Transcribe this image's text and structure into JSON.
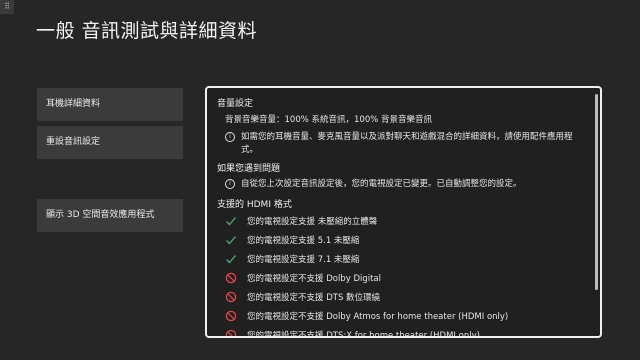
{
  "corner_glyph": "⠿",
  "title": "一般  音訊測試與詳細資料",
  "sidebar": [
    {
      "label": "耳機詳細資料"
    },
    {
      "label": "重設音訊設定"
    },
    {
      "label": "顯示 3D 空間音效應用程式"
    }
  ],
  "panel": {
    "volume_heading": "音量設定",
    "volume_line": "背景音樂音量：100% 系統音訊，100% 背景音樂音訊",
    "volume_info": "如需您的耳機音量、麥克風音量以及派對聊天和遊戲混合的詳細資料，請使用配件應用程式。",
    "problem_heading": "如果您遇到問題",
    "problem_info": "自從您上次設定音訊設定後，您的電視設定已變更。已自動調整您的設定。",
    "hdmi_heading": "支援的 HDMI 格式",
    "formats": [
      {
        "status": "supported",
        "icon": "check-icon",
        "text": "您的電視設定支援 未壓縮的立體聲"
      },
      {
        "status": "supported",
        "icon": "check-icon",
        "text": "您的電視設定支援 5.1 未壓縮"
      },
      {
        "status": "supported",
        "icon": "check-icon",
        "text": "您的電視設定支援 7.1 未壓縮"
      },
      {
        "status": "unsupported",
        "icon": "prohibited-icon",
        "text": "您的電視設定不支援 Dolby Digital"
      },
      {
        "status": "unsupported",
        "icon": "prohibited-icon",
        "text": "您的電視設定不支援 DTS 數位環繞"
      },
      {
        "status": "unsupported",
        "icon": "prohibited-icon",
        "text": "您的電視設定不支援 Dolby Atmos for home theater (HDMI only)"
      },
      {
        "status": "unsupported",
        "icon": "prohibited-icon",
        "text": "您的電視設定不支援 DTS:X for home theater (HDMI only)"
      }
    ]
  },
  "colors": {
    "check": "#4caf6a",
    "prohibited": "#e0454a",
    "background": "#262626",
    "panel_border": "#f0f0f0"
  }
}
